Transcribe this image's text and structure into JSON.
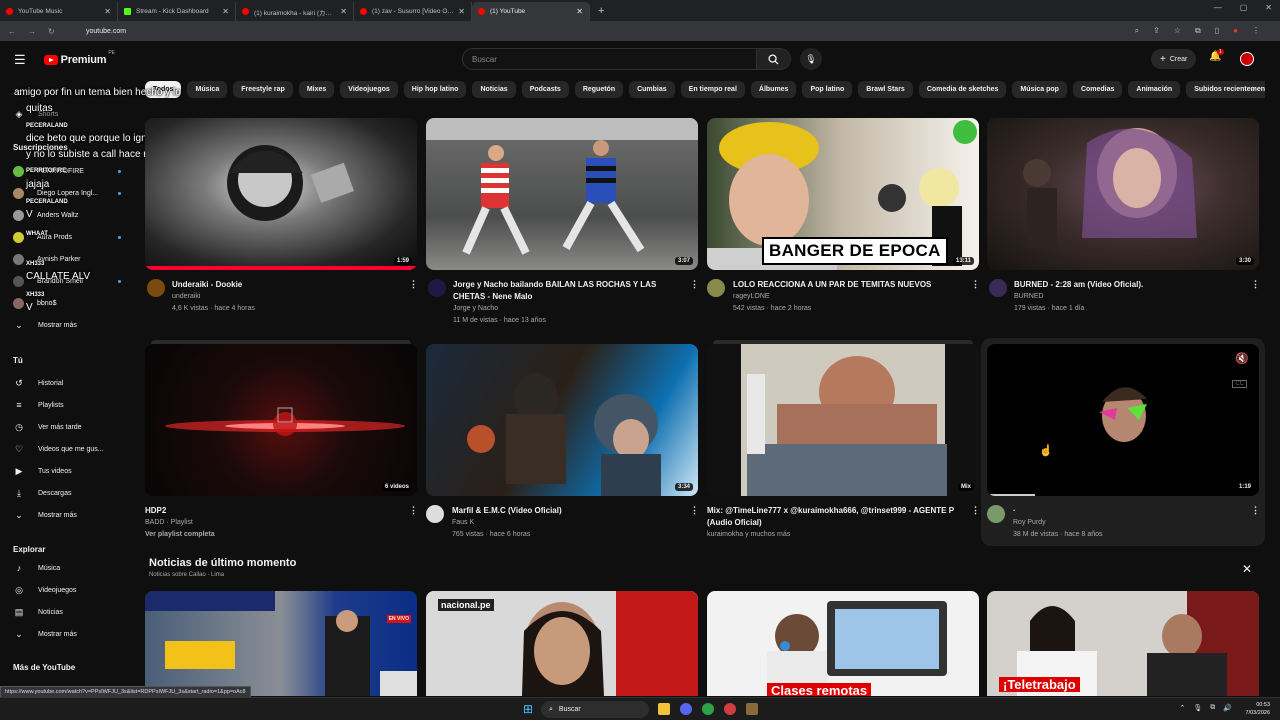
{
  "browser": {
    "tabs": [
      {
        "label": "YouTube Music",
        "color": "#ff0000"
      },
      {
        "label": "Stream - Kick Dashboard",
        "color": "#53fc18"
      },
      {
        "label": "(1) kuraimokha - kairi (カイリ) (a...",
        "color": "#ff0000"
      },
      {
        "label": "(1) zav - Susurro [Video Oficial]",
        "color": "#ff0000"
      },
      {
        "label": "(1) YouTube",
        "color": "#ff0000"
      }
    ],
    "url": "youtube.com",
    "status_url": "https://www.youtube.com/watch?v=PPsIWFJU_3s&list=RDPPsIWFJU_3s&start_radio=1&pp=oAc8"
  },
  "masthead": {
    "logo": "Premium",
    "region": "PE",
    "search_placeholder": "Buscar",
    "create_label": "Crear",
    "notif_count": "1"
  },
  "chips": [
    "Todos",
    "Música",
    "Freestyle rap",
    "Mixes",
    "Videojuegos",
    "Hip hop latino",
    "Noticias",
    "Podcasts",
    "Reguetón",
    "Cumbias",
    "En tiempo real",
    "Álbumes",
    "Pop latino",
    "Brawl Stars",
    "Comedia de sketches",
    "Música pop",
    "Comedias",
    "Animación",
    "Subidos recientemente"
  ],
  "sidebar": {
    "top_items": [
      "Inicio",
      "Shorts"
    ],
    "subs_title": "Suscripciones",
    "subs": [
      "PERRITOFIRE",
      "Diego Lopera Ingl...",
      "Anders Waltz",
      "Aura Prods",
      "Avnish Parker",
      "Brandon Smell",
      "bbno$"
    ],
    "show_more": "Mostrar más",
    "you_title": "Tú",
    "you_items": [
      "Historial",
      "Playlists",
      "Ver más tarde",
      "Videos que me gus...",
      "Tus videos",
      "Descargas",
      "Mostrar más"
    ],
    "explore_title": "Explorar",
    "explore_items": [
      "Música",
      "Videojuegos",
      "Noticias",
      "Mostrar más"
    ],
    "more_title": "Más de YouTube"
  },
  "chat_overlay": {
    "msg1": "amigo por fin un tema bien hecho y lo",
    "msg1b": "quitas",
    "user1": "PECERALAND",
    "msg2": "dice beto que porque lo ignoraste",
    "msg2b": "y no lo subiste a call hace rato",
    "user2": "PERRITOFIRE",
    "msg3": "jajaja",
    "user3": "PECERALAND",
    "msg4": "V",
    "user4": "WHAAT",
    "user5": "XH333",
    "msg5": "CALLATE ALV",
    "user6": "XH333",
    "msg6": "V"
  },
  "videos": [
    {
      "title": "Underaiki - Dookie",
      "title2": "",
      "channel": "underaiki",
      "meta": "4,6 K vistas · hace 4 horas",
      "duration": "1:59"
    },
    {
      "title": "Jorge y Nacho bailando BAILAN LAS ROCHAS Y LAS",
      "title2": "CHETAS - Nene Malo",
      "channel": "Jorge y Nacho",
      "meta": "11 M de vistas · hace 13 años",
      "duration": "3:07"
    },
    {
      "title": "LOLO REACCIONA A UN PAR DE TEMITAS NUEVOS",
      "title2": "",
      "channel": "rageyLONE",
      "meta": "542 vistas · hace 2 horas",
      "duration": "13:11",
      "overlay": "BANGER DE EPOCA"
    },
    {
      "title": "BURNED - 2:28 am (Video Oficial).",
      "title2": "",
      "channel": "BURNED",
      "meta": "179 vistas · hace 1 día",
      "duration": "3:30"
    },
    {
      "title": "HDP2",
      "title2": "",
      "channel": "BADD · Playlist",
      "meta": "Ver playlist completa",
      "duration": "6 videos"
    },
    {
      "title": "Marfil & E.M.C (Video Oficial)",
      "title2": "",
      "channel": "Faus K",
      "meta": "765 vistas · hace 6 horas",
      "duration": "3:34"
    },
    {
      "title": "Mix: @TimeLine777 x @kuraimokha666, @trinset999 - AGENTE P",
      "title2": "(Audio Oficial)",
      "channel": "kuraimokha y muchos más",
      "meta": "",
      "duration": "Mix"
    },
    {
      "title": ".",
      "title2": "",
      "channel": "Roy Purdy",
      "meta": "38 M de vistas · hace 8 años",
      "duration": "1:19"
    }
  ],
  "news": {
    "title": "Noticias de último momento",
    "subtitle": "Noticias sobre Callao · Lima",
    "card_labels": [
      "EN VIVO",
      "nacional.pe",
      "Clases remotas",
      "¡Teletrabajo"
    ]
  },
  "taskbar": {
    "search": "Buscar",
    "time": "00:53",
    "date": "7/03/2026"
  }
}
